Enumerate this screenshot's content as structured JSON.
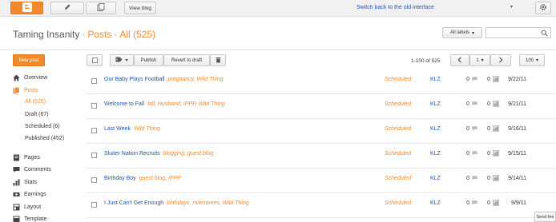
{
  "topbar": {
    "view_blog_label": "View blog",
    "switch_link": "Switch back to the old interface",
    "dropdown_caret": "▾",
    "brand_color": "#f4892c"
  },
  "header": {
    "blog_name": "Taming Insanity",
    "section": "Posts",
    "filter": "All (525)",
    "labels_button": "All labels",
    "search_placeholder": ""
  },
  "sidebar": {
    "new_post": "New post",
    "items_top": [
      {
        "label": "Overview",
        "icon": "home-icon"
      },
      {
        "label": "Posts",
        "icon": "posts-icon",
        "active": true
      }
    ],
    "post_filters": [
      {
        "label": "All (525)",
        "active": true
      },
      {
        "label": "Draft (67)"
      },
      {
        "label": "Scheduled (6)"
      },
      {
        "label": "Published (452)"
      }
    ],
    "items_bottom": [
      {
        "label": "Pages",
        "icon": "pages-icon"
      },
      {
        "label": "Comments",
        "icon": "comments-icon"
      },
      {
        "label": "Stats",
        "icon": "stats-icon"
      },
      {
        "label": "Earnings",
        "icon": "earnings-icon"
      },
      {
        "label": "Layout",
        "icon": "layout-icon"
      },
      {
        "label": "Template",
        "icon": "template-icon"
      }
    ]
  },
  "toolbar": {
    "publish": "Publish",
    "revert": "Revert to draft",
    "range": "1-100 of 525",
    "page": "1",
    "per_page": "100"
  },
  "posts": [
    {
      "title": "Our Baby Plays Football",
      "labels": "pregnancy, Wild Thing",
      "status": "Scheduled",
      "author": "KLZ",
      "comments": "0",
      "views": "0",
      "date": "9/22/11"
    },
    {
      "title": "Welcome to Fall",
      "labels": "fall, Husband, IPPP, Wild Thing",
      "status": "Scheduled",
      "author": "KLZ",
      "comments": "0",
      "views": "0",
      "date": "9/21/11"
    },
    {
      "title": "Last Week",
      "labels": "Wild Thing",
      "status": "Scheduled",
      "author": "KLZ",
      "comments": "0",
      "views": "0",
      "date": "9/16/11"
    },
    {
      "title": "Sluiter Nation Recruits",
      "labels": "blogging, guest blog",
      "status": "Scheduled",
      "author": "KLZ",
      "comments": "0",
      "views": "0",
      "date": "9/15/11"
    },
    {
      "title": "Birthday Boy",
      "labels": "guest blog, IPPP",
      "status": "Scheduled",
      "author": "KLZ",
      "comments": "0",
      "views": "0",
      "date": "9/14/11"
    },
    {
      "title": "I Just Can't Get Enough",
      "labels": "birthdays, milestones, Wild Thing",
      "status": "Scheduled",
      "author": "KLZ",
      "comments": "0",
      "views": "0",
      "date": "9/9/11"
    }
  ],
  "feedback": "Send fee"
}
